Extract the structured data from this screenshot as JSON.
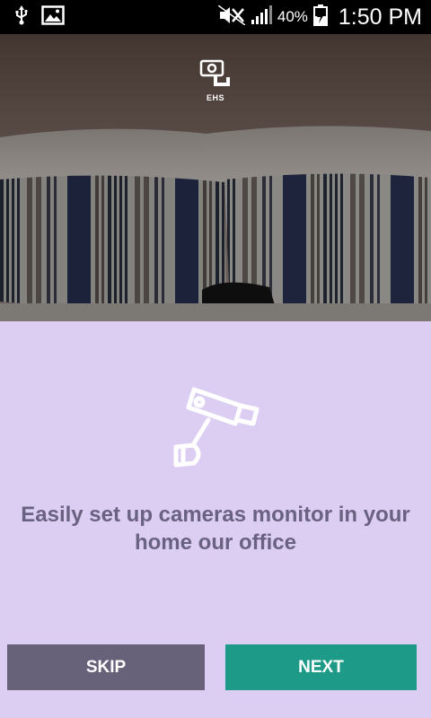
{
  "status_bar": {
    "icons_left": [
      "usb-icon",
      "image-notification-icon"
    ],
    "icons_right": [
      "mute-icon",
      "signal-icon",
      "battery-charging-icon"
    ],
    "battery": "40%",
    "time": "1:50 PM"
  },
  "hero": {
    "brand_text": "EHS",
    "brand_icon": "security-camera-icon"
  },
  "onboarding": {
    "illustration_icon": "security-camera-icon",
    "headline": "Easily set up cameras monitor in your home our office",
    "skip_label": "SKIP",
    "next_label": "NEXT"
  },
  "colors": {
    "background": "#dccdf3",
    "headline": "#6a6281",
    "skip_button": "#676179",
    "next_button": "#1e9a88"
  }
}
